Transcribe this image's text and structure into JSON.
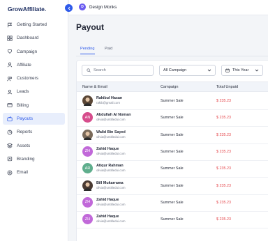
{
  "app": {
    "logo": "GrowAffiliate."
  },
  "sidebar": {
    "items": [
      {
        "label": "Getting Started",
        "icon": "flag-icon",
        "active": false
      },
      {
        "label": "Dashboard",
        "icon": "dashboard-icon",
        "active": false
      },
      {
        "label": "Campaign",
        "icon": "campaign-icon",
        "active": false
      },
      {
        "label": "Affiliate",
        "icon": "user-icon",
        "active": false
      },
      {
        "label": "Customers",
        "icon": "users-icon",
        "active": false
      },
      {
        "label": "Leads",
        "icon": "leads-icon",
        "active": false
      },
      {
        "label": "Billing",
        "icon": "billing-icon",
        "active": false
      },
      {
        "label": "Payouts",
        "icon": "wallet-icon",
        "active": true
      },
      {
        "label": "Reports",
        "icon": "reports-icon",
        "active": false
      },
      {
        "label": "Assets",
        "icon": "assets-icon",
        "active": false
      },
      {
        "label": "Branding",
        "icon": "branding-icon",
        "active": false
      },
      {
        "label": "Email",
        "icon": "email-icon",
        "active": false
      }
    ]
  },
  "topbar": {
    "workspace_initial": "D",
    "workspace_name": "Design Monks"
  },
  "page": {
    "title": "Payout"
  },
  "tabs": [
    {
      "label": "Pending",
      "active": true
    },
    {
      "label": "Paid",
      "active": false
    }
  ],
  "filters": {
    "search_placeholder": "Search",
    "campaign_select": "All Campaign",
    "period_select": "This Year"
  },
  "table": {
    "headers": {
      "name": "Name & Email",
      "campaign": "Campaign",
      "total": "Total Unpaid"
    },
    "rows": [
      {
        "initials": "",
        "photo": true,
        "name": "Rakibul Hasan",
        "email": "rakib@gmail.com",
        "campaign": "Summer Sale",
        "amount": "$ 235.23",
        "color": "#5a4636"
      },
      {
        "initials": "AN",
        "photo": false,
        "name": "Abdullah Al Noman",
        "email": "olivia@untitledui.com",
        "campaign": "Summer Sale",
        "amount": "$ 235.23",
        "color": "#d64d8c"
      },
      {
        "initials": "",
        "photo": true,
        "name": "Walid Bin Sayed",
        "email": "olivia@untitledui.com",
        "campaign": "Summer Sale",
        "amount": "$ 235.23",
        "color": "#7a6a5a"
      },
      {
        "initials": "ZH",
        "photo": false,
        "name": "Zahid Haque",
        "email": "olivia@untitledui.com",
        "campaign": "Summer Sale",
        "amount": "$ 235.23",
        "color": "#c169d9"
      },
      {
        "initials": "AR",
        "photo": false,
        "name": "Atiqur Rahman",
        "email": "olivia@untitledui.com",
        "campaign": "Summer Sale",
        "amount": "$ 235.23",
        "color": "#5fae8d"
      },
      {
        "initials": "",
        "photo": true,
        "name": "Bill Mukarrama",
        "email": "olivia@untitledui.com",
        "campaign": "Summer Sale",
        "amount": "$ 235.23",
        "color": "#4a3b33"
      },
      {
        "initials": "ZH",
        "photo": false,
        "name": "Zahid Haque",
        "email": "olivia@untitledui.com",
        "campaign": "Summer Sale",
        "amount": "$ 235.23",
        "color": "#c169d9"
      },
      {
        "initials": "ZH",
        "photo": false,
        "name": "Zahid Haque",
        "email": "olivia@untitledui.com",
        "campaign": "Summer Sale",
        "amount": "$ 235.23",
        "color": "#c169d9"
      }
    ]
  },
  "colors": {
    "accent": "#2f5bea",
    "amount": "#e5484d",
    "active_bg": "#e8eefc"
  }
}
